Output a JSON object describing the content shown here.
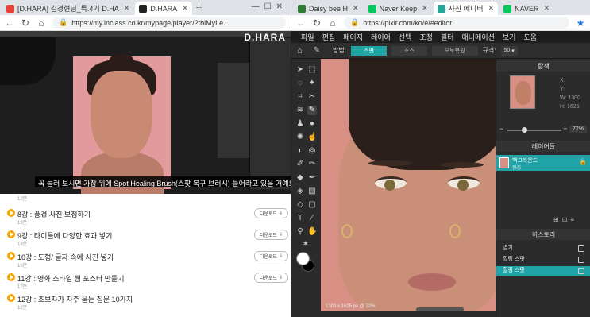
{
  "left_window": {
    "tabs": [
      {
        "label": "[D.HARA] 김경현님_특.4기 D.HA",
        "color": "#e94235"
      },
      {
        "label": "D.HARA",
        "color": "#222222"
      }
    ],
    "url": "https://my.inclass.co.kr/mypage/player/?tblMyLe...",
    "video": {
      "logo": "D.HARA",
      "subtitle": "꼭 눌러 보시면 가장 위에 Spot Healing Brush(스팟 복구 브러시) 들어라고 있을 거예요."
    },
    "lessons": [
      {
        "title": "",
        "duration": "12분",
        "download": ""
      },
      {
        "title": "8강 : 풍경 사진 보정하기",
        "duration": "19분",
        "download": "다운로드"
      },
      {
        "title": "9강 : 타이틀에 다양한 효과 넣기",
        "duration": "18분",
        "download": "다운로드"
      },
      {
        "title": "10강 : 도형/ 글자 속에 사진 넣기",
        "duration": "16분",
        "download": "다운로드"
      },
      {
        "title": "11강 : 영화 스타일 웹 포스터 만들기",
        "duration": "17분",
        "download": "다운로드"
      },
      {
        "title": "12강 : 초보자가 자주 묻는 질문 10가지",
        "duration": "12분",
        "download": ""
      }
    ]
  },
  "right_window": {
    "tabs": [
      {
        "label": "Daisy bee H",
        "color": "#2e7d32"
      },
      {
        "label": "Naver Keep",
        "color": "#03c75a"
      },
      {
        "label": "사진 에디터",
        "color": "#26a69a"
      },
      {
        "label": "NAVER",
        "color": "#03c75a"
      }
    ],
    "url": "https://pixlr.com/ko/e/#editor",
    "menu": [
      "파일",
      "편집",
      "페이지",
      "레이어",
      "선택",
      "조정",
      "필터",
      "애니메이션",
      "보기",
      "도움"
    ],
    "options": {
      "mode_label": "방법:",
      "modes": [
        "스팟",
        "소스",
        "오토복원"
      ],
      "size_label": "규격:",
      "size_value": "50"
    },
    "status": "1300 x 1625 px @ 72%",
    "navigator": {
      "title": "탐색",
      "x_label": "X:",
      "y_label": "Y:",
      "w_label": "W:",
      "w_value": "1300",
      "h_label": "H:",
      "h_value": "1625",
      "zoom": "72",
      "zoom_unit": "%"
    },
    "layers": {
      "title": "레이어들",
      "items": [
        {
          "name": "백그라운드",
          "sub": "잠김"
        }
      ]
    },
    "history": {
      "title": "히스토리",
      "items": [
        "열기",
        "힐링 스팟",
        "힐링 스팟"
      ]
    }
  }
}
